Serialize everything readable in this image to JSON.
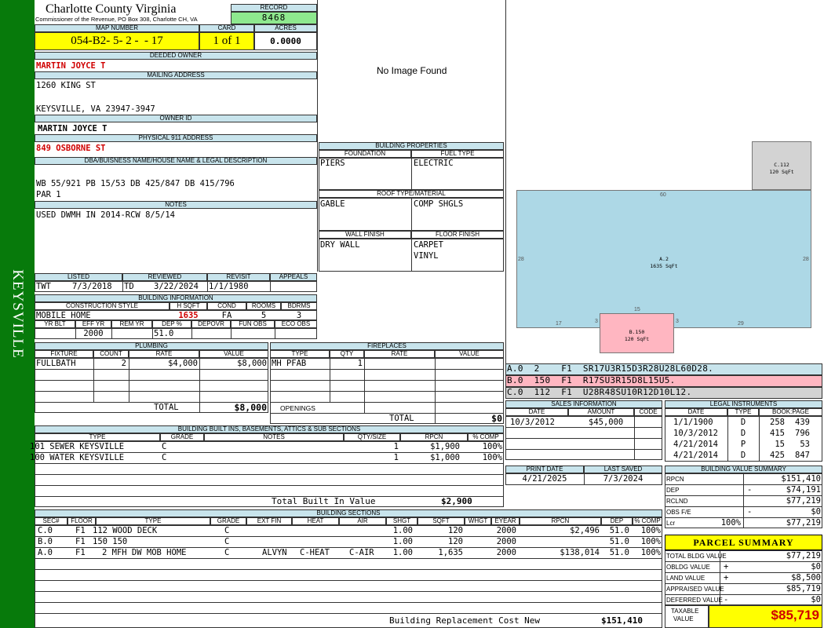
{
  "sidebar": {
    "label": "KEYSVILLE"
  },
  "header": {
    "county": "Charlotte County Virginia",
    "subtitle": "Commissioner of the Revenue, PO Box 308, Charlotte CH, VA",
    "record_label": "RECORD",
    "record_value": "8468",
    "map_label": "MAP NUMBER",
    "map_value": "054-B2- 5- 2 -  - 17",
    "card_label": "CARD",
    "card_value": "1 of 1",
    "acres_label": "ACRES",
    "acres_value": "0.0000"
  },
  "owner": {
    "deeded_label": "DEEDED OWNER",
    "deeded_value": "MARTIN JOYCE T",
    "mailing_label": "MAILING ADDRESS",
    "mailing_line1": "1260 KING ST",
    "mailing_line2": "KEYSVILLE, VA 23947-3947",
    "owner_id_label": "OWNER ID",
    "owner_id_value": "MARTIN JOYCE T",
    "physical_label": "PHYSICAL 911 ADDRESS",
    "physical_value": "849 OSBORNE ST",
    "dba_label": "DBA/BUISNESS NAME/HOUSE NAME & LEGAL DESCRIPTION",
    "dba_line1": "WB 55/921 PB 15/53 DB 425/847 DB 415/796",
    "dba_line2": "PAR 1",
    "notes_label": "NOTES",
    "notes_value": "USED DWMH IN 2014-RCW 8/5/14"
  },
  "photo": {
    "text": "No Image Found"
  },
  "building_properties": {
    "title": "BUILDING PROPERTIES",
    "foundation_label": "FOUNDATION",
    "foundation_value": "PIERS",
    "fuel_label": "FUEL TYPE",
    "fuel_value": "ELECTRIC",
    "roof_label": "ROOF TYPE/MATERIAL",
    "roof_type": "GABLE",
    "roof_material": "COMP SHGLS",
    "wall_label": "WALL FINISH",
    "wall_value": "DRY WALL",
    "floor_label": "FLOOR FINISH",
    "floor_line1": "CARPET",
    "floor_line2": "VINYL"
  },
  "listing": {
    "listed_label": "LISTED",
    "listed_by": "TWT",
    "listed_date": "7/3/2018",
    "reviewed_label": "REVIEWED",
    "reviewed_by": "TD",
    "reviewed_date": "3/22/2024",
    "revisit_label": "REVISIT",
    "revisit_value": "1/1/1980",
    "appeals_label": "APPEALS",
    "appeals_value": ""
  },
  "building_info": {
    "title": "BUILDING INFORMATION",
    "style_label": "CONSTRUCTION STYLE",
    "style_value": "MOBILE HOME",
    "hsqft_label": "H SQFT",
    "hsqft_value": "1635",
    "cond_label": "COND",
    "cond_value": "FA",
    "rooms_label": "ROOMS",
    "rooms_value": "5",
    "bdrms_label": "BDRMS",
    "bdrms_value": "3",
    "yrblt_label": "YR BLT",
    "yrblt_value": "",
    "effyr_label": "EFF YR",
    "effyr_value": "2000",
    "remyr_label": "REM YR",
    "remyr_value": "",
    "dep_label": "DEP %",
    "dep_value": "51.0",
    "depovr_label": "DEPOVR",
    "depovr_value": "",
    "funobs_label": "FUN OBS",
    "funobs_value": "",
    "ecoobs_label": "ECO OBS",
    "ecoobs_value": ""
  },
  "plumbing": {
    "title": "PLUMBING",
    "col_fixture": "FIXTURE",
    "col_count": "COUNT",
    "col_rate": "RATE",
    "col_value": "VALUE",
    "rows": [
      {
        "fixture": "FULLBATH",
        "count": "2",
        "rate": "$4,000",
        "value": "$8,000"
      }
    ],
    "total_label": "TOTAL",
    "total_value": "$8,000"
  },
  "fireplaces": {
    "title": "FIREPLACES",
    "col_type": "TYPE",
    "col_qty": "QTY",
    "col_rate": "RATE",
    "col_value": "VALUE",
    "rows": [
      {
        "type": "MH PFAB",
        "qty": "1",
        "rate": "",
        "value": ""
      }
    ],
    "openings_label": "OPENINGS",
    "total_label": "TOTAL",
    "total_value": "$0"
  },
  "sketch": {
    "card_label": "C.112",
    "card_sqft": "120 SqFt",
    "main_label": "A.2",
    "main_sqft": "1635 SqFt",
    "porch_label": "B.150",
    "porch_sqft": "120 SqFt",
    "dim_top": "60",
    "dim_left": "28",
    "dim_right": "28",
    "dim_bottom_left": "17",
    "dim_bottom_right": "29",
    "dim_porch_top": "15",
    "dim_porch_left": "3",
    "dim_porch_right": "3"
  },
  "sketch_codes": [
    {
      "code": "A.0  2    F1  SR17U3R15D3R28U28L60D28."
    },
    {
      "code": "B.0  150  F1  R17SU3R15D8L15U5."
    },
    {
      "code": "C.0  112  F1  U28R48SU10R12D10L12."
    }
  ],
  "sales": {
    "title": "SALES INFORMATION",
    "col_date": "DATE",
    "col_amount": "AMOUNT",
    "col_code": "CODE",
    "rows": [
      {
        "date": "10/3/2012",
        "amount": "$45,000",
        "code": ""
      }
    ]
  },
  "legal": {
    "title": "LEGAL INSTRUMENTS",
    "col_date": "DATE",
    "col_type": "TYPE",
    "col_book": "BOOK:PAGE",
    "rows": [
      {
        "date": "1/1/1900",
        "type": "D",
        "book": "258",
        "page": "439"
      },
      {
        "date": "10/3/2012",
        "type": "D",
        "book": "415",
        "page": "796"
      },
      {
        "date": "4/21/2014",
        "type": "P",
        "book": "15",
        "page": "53"
      },
      {
        "date": "4/21/2014",
        "type": "D",
        "book": "425",
        "page": "847"
      }
    ]
  },
  "print": {
    "print_label": "PRINT DATE",
    "print_value": "4/21/2025",
    "saved_label": "LAST SAVED",
    "saved_value": "7/3/2024"
  },
  "builtins": {
    "title": "BUILDING BUILT INS, BASEMENTS, ATTICS & SUB SECTIONS",
    "col_type": "TYPE",
    "col_grade": "GRADE",
    "col_notes": "NOTES",
    "col_qty": "QTY/SIZE",
    "col_rpcn": "RPCN",
    "col_comp": "% COMP",
    "rows": [
      {
        "type": "101 SEWER KEYSVILLE",
        "grade": "C",
        "notes": "",
        "qty": "1",
        "rpcn": "$1,900",
        "comp": "100%"
      },
      {
        "type": "100 WATER KEYSVILLE",
        "grade": "C",
        "notes": "",
        "qty": "1",
        "rpcn": "$1,000",
        "comp": "100%"
      }
    ],
    "total_label": "Total Built In Value",
    "total_value": "$2,900"
  },
  "bvs": {
    "title": "BUILDING VALUE SUMMARY",
    "rows": [
      {
        "label": "RPCN",
        "sign": "",
        "value": "$151,410"
      },
      {
        "label": "DEP",
        "sign": "-",
        "value": "$74,191"
      },
      {
        "label": "RCLND",
        "sign": "",
        "value": "$77,219"
      },
      {
        "label": "OBS F/E",
        "sign": "-",
        "value": "$0"
      },
      {
        "label": "Lcr",
        "pct": "100%",
        "sign": "",
        "value": "$77,219"
      }
    ]
  },
  "sections": {
    "title": "BUILDING SECTIONS",
    "cols": {
      "sec": "SEC#",
      "floor": "FLOOR",
      "type": "TYPE",
      "grade": "GRADE",
      "extfin": "EXT FIN",
      "heat": "HEAT",
      "air": "AIR",
      "shgt": "SHGT",
      "sqft": "SQFT",
      "whgt": "WHGT",
      "eyear": "EYEAR",
      "rpcn": "RPCN",
      "dep": "DEP",
      "comp": "% COMP"
    },
    "rows": [
      {
        "sec": "C.0",
        "floor": "F1",
        "type": "112 WOOD DECK",
        "grade": "C",
        "extfin": "",
        "heat": "",
        "air": "",
        "shgt": "1.00",
        "sqft": "120",
        "whgt": "",
        "eyear": "2000",
        "rpcn": "$2,496",
        "dep": "51.0",
        "comp": "100%"
      },
      {
        "sec": "B.0",
        "floor": "F1",
        "type": "150 150",
        "grade": "C",
        "extfin": "",
        "heat": "",
        "air": "",
        "shgt": "1.00",
        "sqft": "120",
        "whgt": "",
        "eyear": "2000",
        "rpcn": "",
        "dep": "51.0",
        "comp": "100%"
      },
      {
        "sec": "A.0",
        "floor": "F1",
        "type": "2 MFH DW MOB HOME",
        "grade": "C",
        "extfin": "ALVYN",
        "heat": "C-HEAT",
        "air": "C-AIR",
        "shgt": "1.00",
        "sqft": "1,635",
        "whgt": "",
        "eyear": "2000",
        "rpcn": "$138,014",
        "dep": "51.0",
        "comp": "100%"
      }
    ],
    "replacement_label": "Building Replacement Cost New",
    "replacement_value": "$151,410"
  },
  "parcel": {
    "title": "PARCEL SUMMARY",
    "rows": [
      {
        "label": "TOTAL BLDG VALUE",
        "sign": "",
        "value": "$77,219"
      },
      {
        "label": "OBLDG VALUE",
        "sign": "+",
        "value": "$0"
      },
      {
        "label": "LAND VALUE",
        "sign": "+",
        "value": "$8,500"
      },
      {
        "label": "APPRAISED VALUE",
        "sign": "",
        "value": "$85,719"
      },
      {
        "label": "DEFERRED VALUE",
        "sign": "-",
        "value": "$0"
      }
    ],
    "taxable_label1": "TAXABLE",
    "taxable_label2": "VALUE",
    "taxable_value": "$85,719"
  },
  "colors": {
    "sidebar": "#077A0B",
    "header_band": "#c8e4ec",
    "yellow": "#ffff00",
    "record_green": "#8ee88e",
    "sketch_main": "#add8e6",
    "sketch_porch": "#ffb6c1",
    "sketch_deck": "#d3d3d3",
    "red": "#d00000"
  }
}
